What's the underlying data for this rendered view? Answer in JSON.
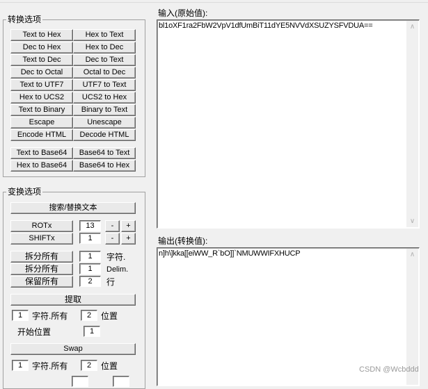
{
  "convert_group": {
    "title": "转换选项",
    "buttons": [
      [
        "Text to Hex",
        "Hex to Text"
      ],
      [
        "Dec to Hex",
        "Hex to Dec"
      ],
      [
        "Text to Dec",
        "Dec to Text"
      ],
      [
        "Dec to Octal",
        "Octal to Dec"
      ],
      [
        "Text to UTF7",
        "UTF7 to Text"
      ],
      [
        "Hex to UCS2",
        "UCS2 to Hex"
      ],
      [
        "Text to Binary",
        "Binary to Text"
      ],
      [
        "Escape",
        "Unescape"
      ],
      [
        "Encode HTML",
        "Decode HTML"
      ]
    ],
    "base64_buttons": [
      [
        "Text to Base64",
        "Base64 to Text"
      ],
      [
        "Hex to Base64",
        "Base64 to Hex"
      ]
    ]
  },
  "transform_group": {
    "title": "变换选项",
    "search_replace": "搜索/替换文本",
    "rotx": {
      "label": "ROTx",
      "value": "13",
      "minus": "-",
      "plus": "+"
    },
    "shiftx": {
      "label": "SHIFTx",
      "value": "1",
      "minus": "-",
      "plus": "+"
    },
    "split_chars": {
      "label": "拆分所有",
      "value": "1",
      "unit": "字符."
    },
    "split_delim": {
      "label": "拆分所有",
      "value": "1",
      "unit": "Delim."
    },
    "keep_lines": {
      "label": "保留所有",
      "value": "2",
      "unit": "行"
    },
    "extract": {
      "label": "提取",
      "chars_value": "1",
      "chars_label": "字符.所有",
      "pos_value": "2",
      "pos_label": "位置",
      "start_label": "开始位置",
      "start_value": "1"
    },
    "swap": {
      "label": "Swap",
      "chars_value": "1",
      "chars_label": "字符.所有",
      "pos_value": "2",
      "pos_label": "位置"
    }
  },
  "input": {
    "label": "输入(原始值):",
    "value": "bl1oXF1ra2FbW2VpV1dfUmBiT11dYE5NVVdXSUZYSFVDUA=="
  },
  "output": {
    "label": "输出(转换值):",
    "value": "n]h\\]kka[[eiWW_R`bO]]`NMUWWIFXHUCP"
  },
  "watermark": "CSDN @Wcbddd"
}
